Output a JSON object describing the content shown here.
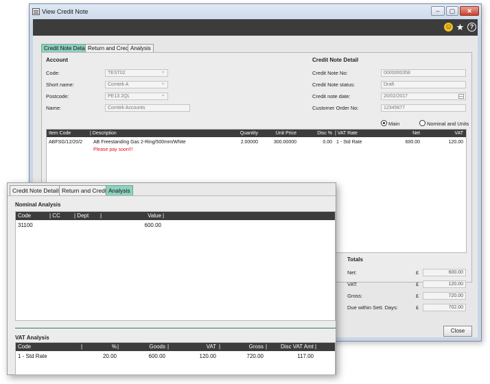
{
  "window": {
    "title": "View Credit Note",
    "controls": {
      "minimize": "–",
      "maximize": "▢",
      "close": "✕"
    }
  },
  "toolbar": {
    "icons": [
      "smiley-icon",
      "star-icon",
      "help-icon"
    ],
    "accent": "#f2c11d"
  },
  "tabs": {
    "details": "Credit Note Details",
    "return_credit": "Return and Credit",
    "analysis": "Analysis"
  },
  "account": {
    "title": "Account",
    "code_label": "Code:",
    "code": "TEST02",
    "short_name_label": "Short name:",
    "short_name": "Comtek A",
    "postcode_label": "Postcode:",
    "postcode": "PE13 2QL",
    "name_label": "Name:",
    "name": "Comtek Accounts"
  },
  "detail": {
    "title": "Credit Note Detail",
    "number_label": "Credit Note No:",
    "number": "0000000358",
    "status_label": "Credit Note status:",
    "status": "Draft",
    "date_label": "Credit note date:",
    "date": "20/02/2017",
    "order_label": "Customer Order No:",
    "order": "12345677"
  },
  "view_mode": {
    "main": "Main",
    "nominal": "Nominal and Units",
    "selected": "main"
  },
  "items": {
    "headers": [
      "Item Code",
      "| Description",
      "Quantity",
      "Unit Price",
      "Disc %",
      "| VAT Rate",
      "Net",
      "VAT"
    ],
    "rows": [
      {
        "code": "ABFSG/12/20/2",
        "description": "AB Freestanding Gas 2-Ring/500mm/White",
        "quantity": "2.00000",
        "unit_price": "300.00000",
        "disc": "0.00",
        "vat_rate": "1 - Std Rate",
        "net": "600.00",
        "vat": "120.00",
        "comment": "Please pay soon!!!"
      }
    ]
  },
  "totals": {
    "title": "Totals",
    "currency": "£",
    "net_label": "Net:",
    "net": "600.00",
    "vat_label": "VAT:",
    "vat": "120.00",
    "gross_label": "Gross:",
    "gross": "720.00",
    "due_label": "Due within Sett. Days:",
    "due": "702.00"
  },
  "close_label": "Close",
  "analysis": {
    "nominal_title": "Nominal Analysis",
    "nominal_headers": [
      "Code",
      "| CC",
      "| Dept",
      "|",
      "Value"
    ],
    "nominal_rows": [
      {
        "code": "31100",
        "value": "600.00"
      }
    ],
    "vat_title": "VAT Analysis",
    "vat_headers": [
      "Code",
      "%",
      "Goods",
      "VAT",
      "Gross",
      "Disc VAT Amt"
    ],
    "vat_rows": [
      {
        "code": "1 - Std Rate",
        "pct": "20.00",
        "goods": "600.00",
        "vat": "120.00",
        "gross": "720.00",
        "disc": "117.00"
      }
    ]
  },
  "colors": {
    "tab_active": "#8fd0bf",
    "header_bar": "#3c3c3c",
    "comment": "#e01010",
    "divider": "#2f7a5a"
  }
}
